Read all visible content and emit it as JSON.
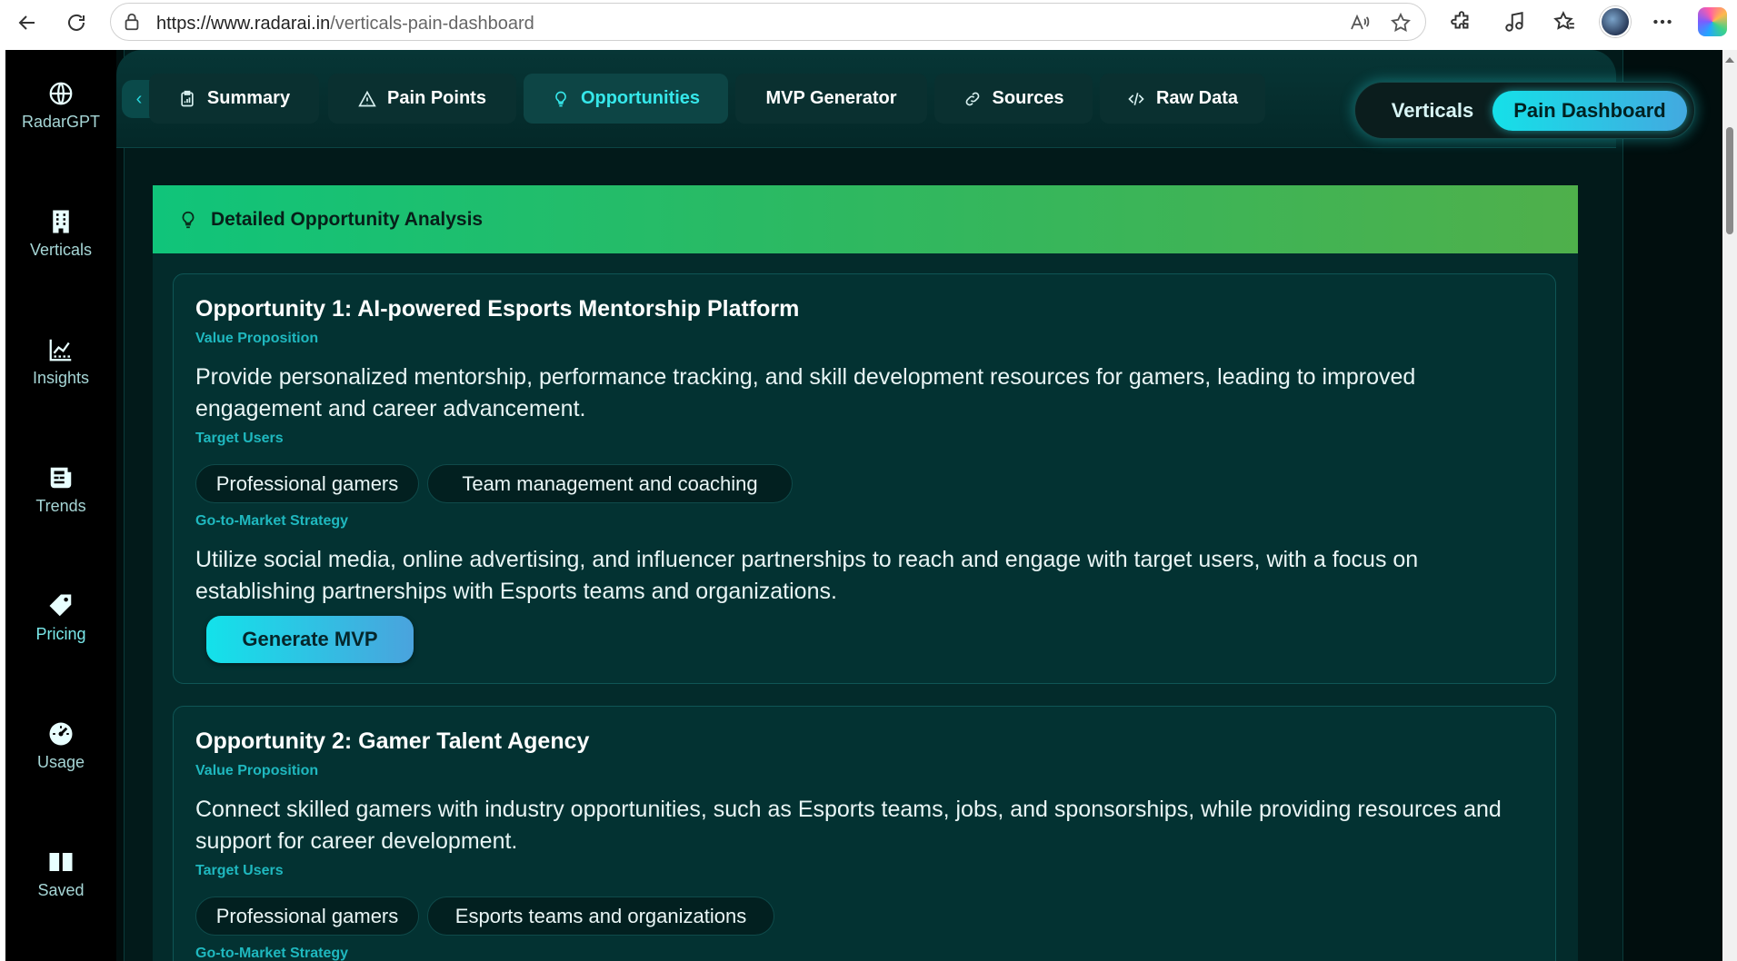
{
  "browser": {
    "url_domain": "https://www.radarai.in",
    "url_path": "/verticals-pain-dashboard"
  },
  "sidebar": {
    "items": [
      {
        "label": "RadarGPT",
        "icon": "globe-icon"
      },
      {
        "label": "Verticals",
        "icon": "building-icon"
      },
      {
        "label": "Insights",
        "icon": "chart-icon"
      },
      {
        "label": "Trends",
        "icon": "newspaper-icon"
      },
      {
        "label": "Pricing",
        "icon": "tag-icon"
      },
      {
        "label": "Usage",
        "icon": "gauge-icon"
      },
      {
        "label": "Saved",
        "icon": "book-icon"
      }
    ]
  },
  "tabs": [
    {
      "label": "Summary",
      "icon": "clipboard-icon"
    },
    {
      "label": "Pain Points",
      "icon": "warning-icon"
    },
    {
      "label": "Opportunities",
      "icon": "lightbulb-icon",
      "active": true
    },
    {
      "label": "MVP Generator"
    },
    {
      "label": "Sources",
      "icon": "link-icon"
    },
    {
      "label": "Raw Data",
      "icon": "code-icon"
    }
  ],
  "view_toggle": {
    "options": [
      "Verticals",
      "Pain Dashboard"
    ],
    "selected": "Pain Dashboard"
  },
  "section": {
    "title": "Detailed Opportunity Analysis"
  },
  "opportunities": [
    {
      "title": "Opportunity 1: AI-powered Esports Mentorship Platform",
      "value_label": "Value Proposition",
      "value_text": "Provide personalized mentorship, performance tracking, and skill development resources for gamers, leading to improved engagement and career advancement.",
      "users_label": "Target Users",
      "users": [
        "Professional gamers",
        "Team management and coaching"
      ],
      "gtm_label": "Go-to-Market Strategy",
      "gtm_text": "Utilize social media, online advertising, and influencer partnerships to reach and engage with target users, with a focus on establishing partnerships with Esports teams and organizations.",
      "button_label": "Generate MVP"
    },
    {
      "title": "Opportunity 2: Gamer Talent Agency",
      "value_label": "Value Proposition",
      "value_text": "Connect skilled gamers with industry opportunities, such as Esports teams, jobs, and sponsorships, while providing resources and support for career development.",
      "users_label": "Target Users",
      "users": [
        "Professional gamers",
        "Esports teams and organizations"
      ],
      "gtm_label": "Go-to-Market Strategy"
    }
  ],
  "colors": {
    "accent": "#28d7de",
    "header_gradient_start": "#10c47a",
    "header_gradient_end": "#4fb04b",
    "background": "#021414"
  }
}
